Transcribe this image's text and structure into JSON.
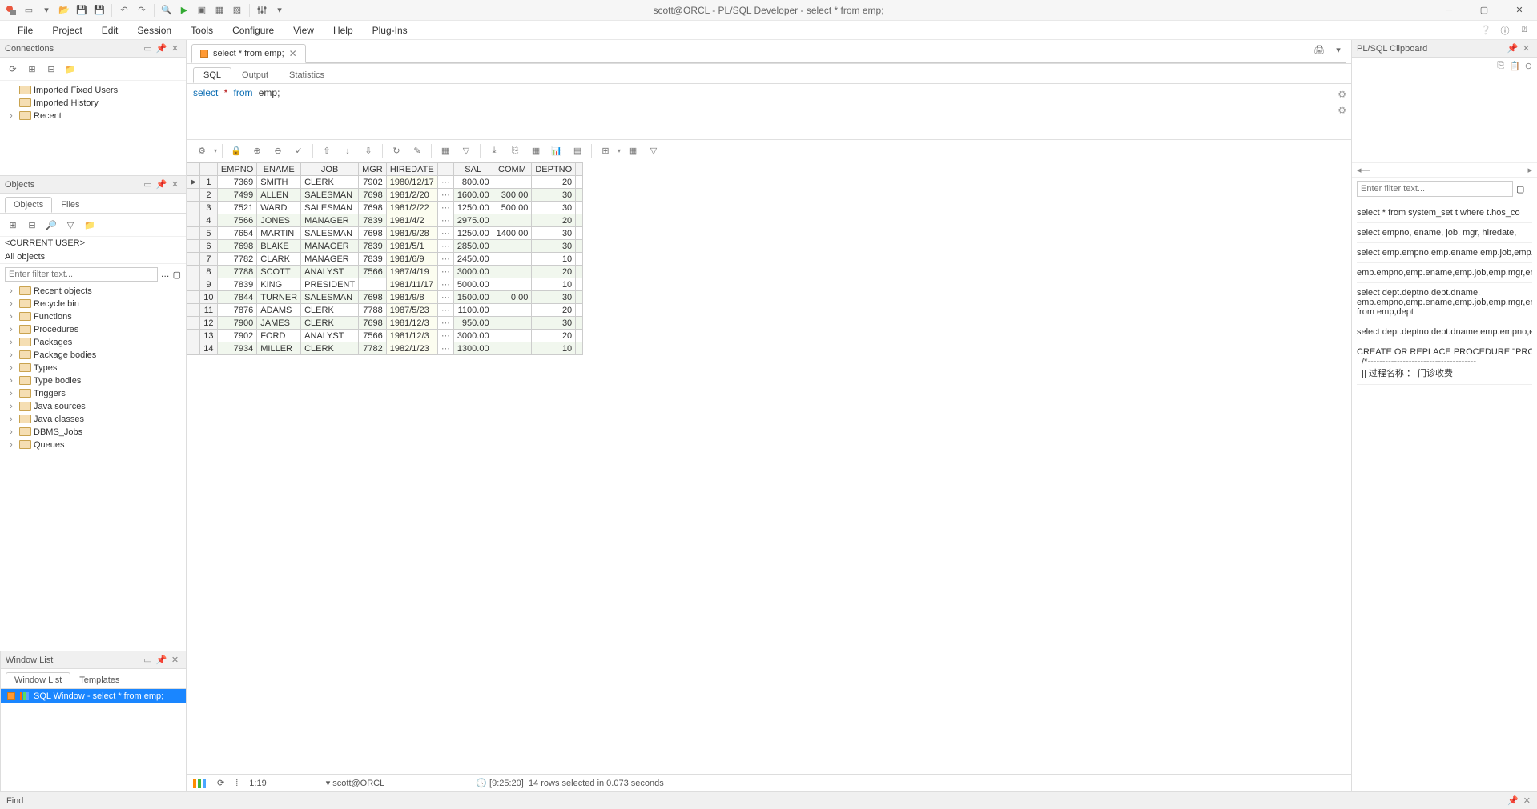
{
  "titlebar": {
    "title": "scott@ORCL - PL/SQL Developer - select * from emp;"
  },
  "menus": [
    "File",
    "Project",
    "Edit",
    "Session",
    "Tools",
    "Configure",
    "View",
    "Help",
    "Plug-Ins"
  ],
  "connections": {
    "title": "Connections",
    "items": [
      "Imported Fixed Users",
      "Imported History",
      "Recent"
    ]
  },
  "objects": {
    "title": "Objects",
    "tabs": [
      "Objects",
      "Files"
    ],
    "current_user": "<CURRENT USER>",
    "scope": "All objects",
    "filter_placeholder": "Enter filter text...",
    "items": [
      "Recent objects",
      "Recycle bin",
      "Functions",
      "Procedures",
      "Packages",
      "Package bodies",
      "Types",
      "Type bodies",
      "Triggers",
      "Java sources",
      "Java classes",
      "DBMS_Jobs",
      "Queues"
    ]
  },
  "windowlist": {
    "title": "Window List",
    "tabs": [
      "Window List",
      "Templates"
    ],
    "item": "SQL Window - select * from emp;"
  },
  "editor": {
    "tab_title": "select * from emp;",
    "inner_tabs": [
      "SQL",
      "Output",
      "Statistics"
    ],
    "sql_kw1": "select",
    "sql_star": "*",
    "sql_kw2": "from",
    "sql_ident": "emp;"
  },
  "grid": {
    "columns": [
      "",
      "",
      "EMPNO",
      "ENAME",
      "JOB",
      "MGR",
      "HIREDATE",
      "",
      "SAL",
      "COMM",
      "DEPTNO",
      ""
    ],
    "rows": [
      {
        "n": 1,
        "empno": 7369,
        "ename": "SMITH",
        "job": "CLERK",
        "mgr": 7902,
        "hiredate": "1980/12/17",
        "sal": "800.00",
        "comm": "",
        "deptno": 20
      },
      {
        "n": 2,
        "empno": 7499,
        "ename": "ALLEN",
        "job": "SALESMAN",
        "mgr": 7698,
        "hiredate": "1981/2/20",
        "sal": "1600.00",
        "comm": "300.00",
        "deptno": 30
      },
      {
        "n": 3,
        "empno": 7521,
        "ename": "WARD",
        "job": "SALESMAN",
        "mgr": 7698,
        "hiredate": "1981/2/22",
        "sal": "1250.00",
        "comm": "500.00",
        "deptno": 30
      },
      {
        "n": 4,
        "empno": 7566,
        "ename": "JONES",
        "job": "MANAGER",
        "mgr": 7839,
        "hiredate": "1981/4/2",
        "sal": "2975.00",
        "comm": "",
        "deptno": 20
      },
      {
        "n": 5,
        "empno": 7654,
        "ename": "MARTIN",
        "job": "SALESMAN",
        "mgr": 7698,
        "hiredate": "1981/9/28",
        "sal": "1250.00",
        "comm": "1400.00",
        "deptno": 30
      },
      {
        "n": 6,
        "empno": 7698,
        "ename": "BLAKE",
        "job": "MANAGER",
        "mgr": 7839,
        "hiredate": "1981/5/1",
        "sal": "2850.00",
        "comm": "",
        "deptno": 30
      },
      {
        "n": 7,
        "empno": 7782,
        "ename": "CLARK",
        "job": "MANAGER",
        "mgr": 7839,
        "hiredate": "1981/6/9",
        "sal": "2450.00",
        "comm": "",
        "deptno": 10
      },
      {
        "n": 8,
        "empno": 7788,
        "ename": "SCOTT",
        "job": "ANALYST",
        "mgr": 7566,
        "hiredate": "1987/4/19",
        "sal": "3000.00",
        "comm": "",
        "deptno": 20
      },
      {
        "n": 9,
        "empno": 7839,
        "ename": "KING",
        "job": "PRESIDENT",
        "mgr": "",
        "hiredate": "1981/11/17",
        "sal": "5000.00",
        "comm": "",
        "deptno": 10
      },
      {
        "n": 10,
        "empno": 7844,
        "ename": "TURNER",
        "job": "SALESMAN",
        "mgr": 7698,
        "hiredate": "1981/9/8",
        "sal": "1500.00",
        "comm": "0.00",
        "deptno": 30
      },
      {
        "n": 11,
        "empno": 7876,
        "ename": "ADAMS",
        "job": "CLERK",
        "mgr": 7788,
        "hiredate": "1987/5/23",
        "sal": "1100.00",
        "comm": "",
        "deptno": 20
      },
      {
        "n": 12,
        "empno": 7900,
        "ename": "JAMES",
        "job": "CLERK",
        "mgr": 7698,
        "hiredate": "1981/12/3",
        "sal": "950.00",
        "comm": "",
        "deptno": 30
      },
      {
        "n": 13,
        "empno": 7902,
        "ename": "FORD",
        "job": "ANALYST",
        "mgr": 7566,
        "hiredate": "1981/12/3",
        "sal": "3000.00",
        "comm": "",
        "deptno": 20
      },
      {
        "n": 14,
        "empno": 7934,
        "ename": "MILLER",
        "job": "CLERK",
        "mgr": 7782,
        "hiredate": "1982/1/23",
        "sal": "1300.00",
        "comm": "",
        "deptno": 10
      }
    ]
  },
  "center_status": {
    "pos": "1:19",
    "conn": "scott@ORCL",
    "time": "[9:25:20]",
    "msg": "14 rows selected in 0.073 seconds"
  },
  "clipboard": {
    "title": "PL/SQL Clipboard",
    "filter_placeholder": "Enter filter text...",
    "entries": [
      "select * from system_set t where t.hos_co",
      "select empno, ename, job, mgr, hiredate,",
      "select emp.empno,emp.ename,emp.job,emp.mg",
      "emp.empno,emp.ename,emp.job,emp.mgr,emp.h",
      "select dept.deptno,dept.dname,\nemp.empno,emp.ename,emp.job,emp.mgr,emp.h\nfrom emp,dept",
      "select dept.deptno,dept.dname,emp.empno,e",
      "CREATE OR REPLACE PROCEDURE \"PRC_MZ_FEE\"\n  /*-------------------------------------\n  || 过程名称 ： 门诊收费"
    ]
  },
  "findbar": {
    "label": "Find"
  }
}
